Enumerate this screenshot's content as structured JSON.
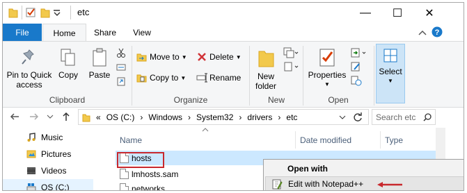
{
  "window": {
    "title": "etc",
    "minimize": "—",
    "maximize": "☐",
    "close": "✕"
  },
  "tabs": {
    "file": "File",
    "home": "Home",
    "share": "Share",
    "view": "View"
  },
  "ribbon": {
    "clipboard": {
      "pin_line1": "Pin to Quick",
      "pin_line2": "access",
      "copy": "Copy",
      "paste": "Paste",
      "label": "Clipboard"
    },
    "organize": {
      "move_to": "Move to",
      "copy_to": "Copy to",
      "delete": "Delete",
      "rename": "Rename",
      "label": "Organize"
    },
    "new": {
      "folder_line1": "New",
      "folder_line2": "folder",
      "label": "New"
    },
    "open": {
      "properties": "Properties",
      "label": "Open"
    },
    "select": {
      "select": "Select"
    }
  },
  "address": {
    "prefix": "«",
    "crumbs": [
      "OS (C:)",
      "Windows",
      "System32",
      "drivers",
      "etc"
    ],
    "search_placeholder": "Search etc"
  },
  "nav": {
    "items": [
      "Music",
      "Pictures",
      "Videos",
      "OS (C:)"
    ]
  },
  "files": {
    "headers": {
      "name": "Name",
      "date": "Date modified",
      "type": "Type"
    },
    "rows": [
      "hosts",
      "lmhosts.sam",
      "networks"
    ]
  },
  "context_menu": {
    "items": [
      "Open with",
      "Edit with Notepad++"
    ]
  },
  "colors": {
    "accent": "#1979ca",
    "highlight": "#c8282d",
    "selection": "#cce8ff"
  }
}
